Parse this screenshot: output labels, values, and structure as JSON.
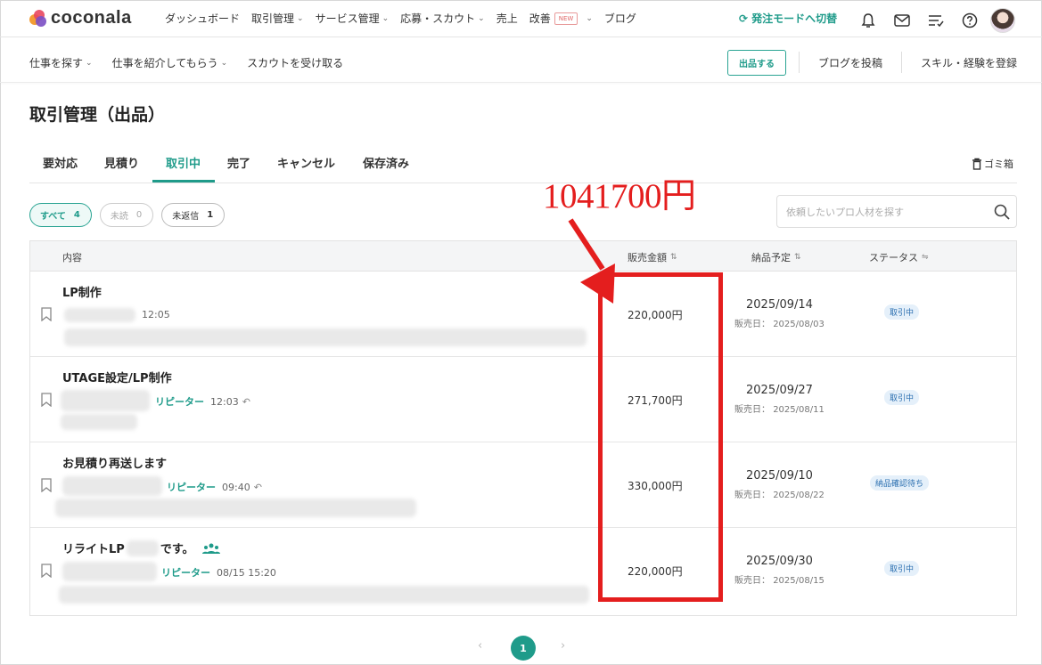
{
  "brand": {
    "name": "coconala",
    "accent": "#1f9b8a",
    "annotation_color": "#e41e1e"
  },
  "topnav": {
    "items": [
      {
        "label": "ダッシュボード",
        "dropdown": false
      },
      {
        "label": "取引管理",
        "dropdown": true
      },
      {
        "label": "サービス管理",
        "dropdown": true
      },
      {
        "label": "応募・スカウト",
        "dropdown": true
      },
      {
        "label": "売上",
        "dropdown": false
      },
      {
        "label": "改善",
        "badge": "NEW",
        "dropdown": true
      },
      {
        "label": "ブログ",
        "dropdown": false
      }
    ],
    "mode_switch": "発注モードへ切替",
    "icons": [
      "bell-icon",
      "mail-icon",
      "checklist-icon",
      "help-icon",
      "avatar"
    ]
  },
  "subnav": {
    "items": [
      {
        "label": "仕事を探す",
        "dropdown": true
      },
      {
        "label": "仕事を紹介してもらう",
        "dropdown": true
      },
      {
        "label": "スカウトを受け取る",
        "dropdown": false
      }
    ],
    "publish": "出品する",
    "blog": "ブログを投稿",
    "skills": "スキル・経験を登録"
  },
  "page": {
    "title": "取引管理（出品）",
    "tabs": [
      "要対応",
      "見積り",
      "取引中",
      "完了",
      "キャンセル",
      "保存済み"
    ],
    "active_tab": "取引中",
    "trash": "ゴミ箱"
  },
  "annotation": {
    "total": "1041700円"
  },
  "filters": [
    {
      "label": "すべて",
      "count": "4",
      "state": "selected"
    },
    {
      "label": "未読",
      "count": "0",
      "state": "disabled"
    },
    {
      "label": "未返信",
      "count": "1",
      "state": "normal"
    }
  ],
  "search": {
    "placeholder": "依頼したいプロ人材を探す"
  },
  "table": {
    "headers": {
      "content": "内容",
      "price": "販売金額",
      "due": "納品予定",
      "status": "ステータス"
    },
    "sale_date_label": "販売日：",
    "rows": [
      {
        "title": "LP制作",
        "repeater": "",
        "time": "12:05",
        "price": "220,000円",
        "due": "2025/09/14",
        "sale_date": "2025/08/03",
        "status": "取引中"
      },
      {
        "title": "UTAGE設定/LP制作",
        "repeater": "リピーター",
        "time": "12:03",
        "price": "271,700円",
        "due": "2025/09/27",
        "sale_date": "2025/08/11",
        "status": "取引中"
      },
      {
        "title": "お見積り再送します",
        "repeater": "リピーター",
        "time": "09:40",
        "price": "330,000円",
        "due": "2025/09/10",
        "sale_date": "2025/08/22",
        "status": "納品確認待ち"
      },
      {
        "title_prefix": "リライトLP",
        "title_suffix": "です。",
        "repeater": "リピーター",
        "time": "08/15 15:20",
        "price": "220,000円",
        "due": "2025/09/30",
        "sale_date": "2025/08/15",
        "status": "取引中"
      }
    ]
  },
  "pagination": {
    "current": "1",
    "prev": "‹",
    "next": "›"
  }
}
